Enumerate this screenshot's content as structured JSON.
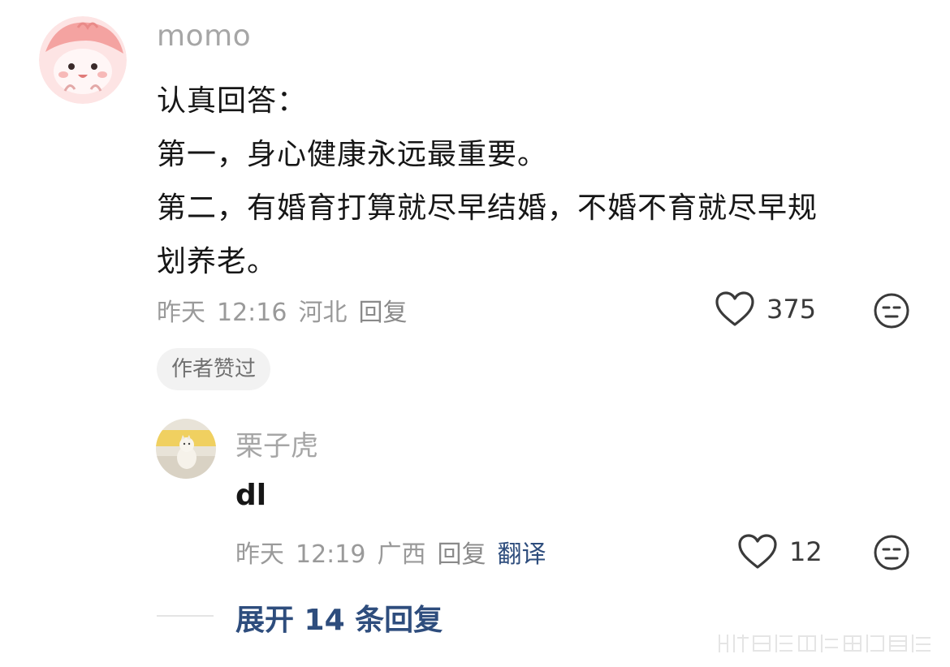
{
  "comment": {
    "username": "momo",
    "lines": [
      "认真回答：",
      "第一，身心健康永远最重要。",
      "第二，有婚育打算就尽早结婚，不婚不育就尽早规",
      "划养老。"
    ],
    "meta": {
      "date": "昨天",
      "time": "12:16",
      "location": "河北",
      "reply_label": "回复"
    },
    "like_count": "375",
    "badge": "作者赞过"
  },
  "reply": {
    "username": "栗子虎",
    "text": "dl",
    "meta": {
      "date": "昨天",
      "time": "12:19",
      "location": "广西",
      "reply_label": "回复",
      "translate_label": "翻译"
    },
    "like_count": "12"
  },
  "expand_label": "展开 14 条回复",
  "colors": {
    "link_blue": "#2e4d7d",
    "meta_gray": "#9a9a9a",
    "badge_bg": "#f2f2f2"
  },
  "icons": [
    "heart-outline-icon",
    "neutral-face-icon",
    "watermark-pattern"
  ]
}
